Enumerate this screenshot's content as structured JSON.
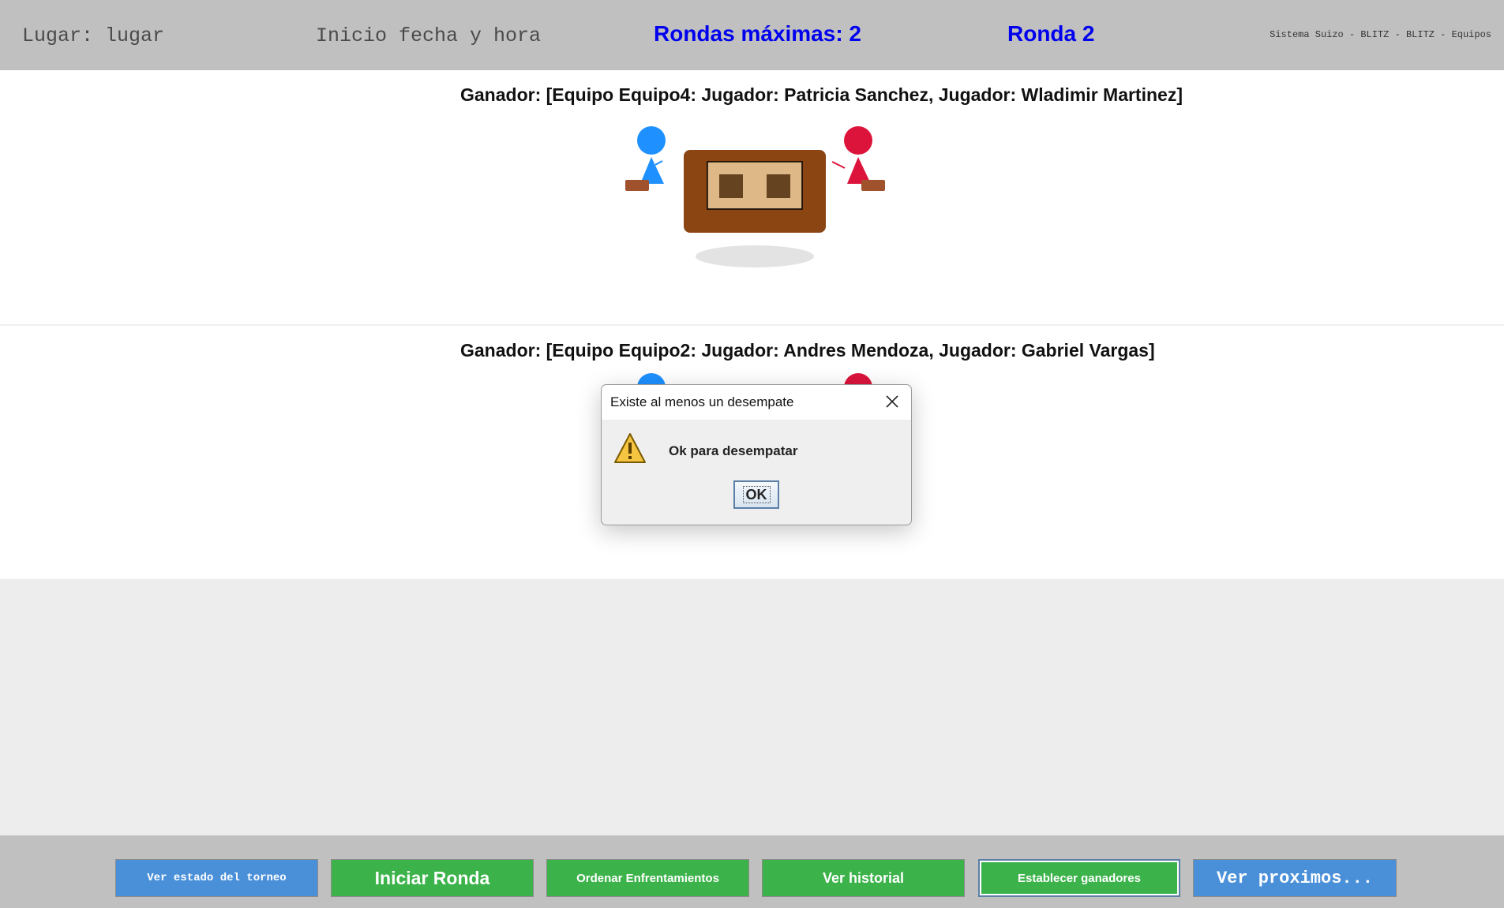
{
  "header": {
    "lugar": "Lugar: lugar",
    "inicio": "Inicio fecha y hora",
    "rondas_maximas": "Rondas máximas: 2",
    "ronda": "Ronda 2",
    "sistema": "Sistema Suizo - BLITZ - BLITZ - Equipos"
  },
  "matches": [
    {
      "winner": "Ganador: [Equipo Equipo4: Jugador: Patricia Sanchez, Jugador: Wladimir Martinez]"
    },
    {
      "winner": "Ganador: [Equipo Equipo2: Jugador: Andres Mendoza, Jugador: Gabriel Vargas]"
    }
  ],
  "dialog": {
    "title": "Existe al menos un desempate",
    "message": "Ok para desempatar",
    "ok_label": "OK"
  },
  "footer": {
    "buttons": [
      {
        "label": "Ver estado del torneo"
      },
      {
        "label": "Iniciar Ronda"
      },
      {
        "label": "Ordenar Enfrentamientos"
      },
      {
        "label": "Ver historial"
      },
      {
        "label": "Establecer ganadores"
      },
      {
        "label": "Ver proximos..."
      }
    ]
  },
  "colors": {
    "player_left": "#1e90ff",
    "player_right": "#dc143c",
    "table": "#8b4513",
    "board": "#deb887",
    "accent_blue": "#0000ee",
    "button_blue": "#4a90d9",
    "button_green": "#3bb34a"
  }
}
